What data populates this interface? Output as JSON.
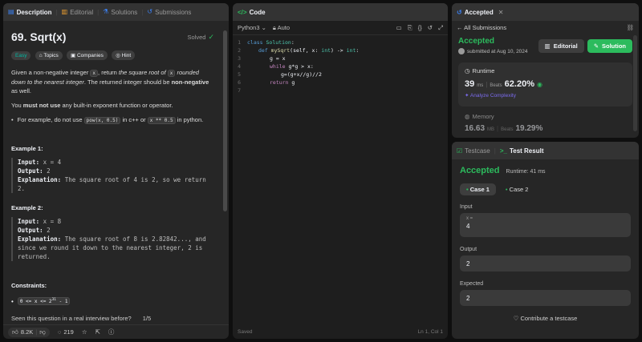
{
  "left": {
    "tabs": [
      {
        "label": "Description"
      },
      {
        "label": "Editorial"
      },
      {
        "label": "Solutions"
      },
      {
        "label": "Submissions"
      }
    ],
    "title": "69. Sqrt(x)",
    "status": "Solved",
    "chips": [
      "Easy",
      "Topics",
      "Companies",
      "Hint"
    ],
    "desc": {
      "p1a": "Given a non-negative integer ",
      "x": "x",
      "p1b": ", return ",
      "p1c": "the square root of ",
      "p1d": " rounded down to the nearest integer",
      "p1e": ". The returned integer should be ",
      "p1f": "non-negative",
      "p1g": " as well.",
      "p2a": "You ",
      "p2b": "must not use",
      "p2c": " any built-in exponent function or operator.",
      "bullet_a": "For example, do not use ",
      "code1": "pow(x, 0.5)",
      "bullet_b": " in c++ or ",
      "code2": "x ** 0.5",
      "bullet_c": " in python."
    },
    "examples": [
      {
        "heading": "Example 1:",
        "input_label": "Input:",
        "input": "x = 4",
        "output_label": "Output:",
        "output": "2",
        "explanation_label": "Explanation:",
        "explanation": "The square root of 4 is 2, so we return 2."
      },
      {
        "heading": "Example 2:",
        "input_label": "Input:",
        "input": "x = 8",
        "output_label": "Output:",
        "output": "2",
        "explanation_label": "Explanation:",
        "explanation": "The square root of 8 is 2.82842..., and since we round it down to the nearest integer, 2 is returned."
      }
    ],
    "constraints_heading": "Constraints:",
    "constraint_base": "0 <= x <= 2",
    "constraint_exp": "31",
    "constraint_tail": " - 1",
    "interview_prompt": "Seen this question in a real interview before?",
    "interview_pages": "1/5",
    "likes": "8.2K",
    "comments": "219"
  },
  "code": {
    "tab": "Code",
    "language": "Python3",
    "mode": "Auto",
    "lines": [
      {
        "n": "1"
      },
      {
        "n": "2"
      },
      {
        "n": "3"
      },
      {
        "n": "4"
      },
      {
        "n": "5"
      },
      {
        "n": "6"
      },
      {
        "n": "7"
      }
    ],
    "text": {
      "class_kw": "class",
      "class_name": "Solution",
      "def_kw": "def",
      "fn_name": "mySqrt",
      "params": "(self, x: ",
      "int1": "int",
      "ret": ") -> ",
      "int2": "int",
      "colon": ":",
      "l3": "g = x",
      "while_kw": "while",
      "l4": " g*g > x:",
      "l5": "g=(g+x//g)//2",
      "return_kw": "return",
      "l6": " g"
    },
    "status_left": "Saved",
    "status_right": "Ln 1, Col 1"
  },
  "submission": {
    "tab": "Accepted",
    "back": "All Submissions",
    "status": "Accepted",
    "submitted": "submitted at Aug 10, 2024",
    "editorial_btn": "Editorial",
    "solution_btn": "Solution",
    "runtime_label": "Runtime",
    "runtime_value": "39",
    "runtime_unit": "ms",
    "beats_label": "Beats",
    "runtime_beats": "62.20%",
    "analyze": "Analyze Complexity",
    "memory_label": "Memory",
    "memory_value": "16.63",
    "memory_unit": "MB",
    "memory_beats": "19.29%"
  },
  "result": {
    "tabs": [
      {
        "label": "Testcase"
      },
      {
        "label": "Test Result"
      }
    ],
    "status": "Accepted",
    "runtime": "Runtime: 41 ms",
    "cases": [
      {
        "label": "Case 1"
      },
      {
        "label": "Case 2"
      }
    ],
    "input_label": "Input",
    "input_var": "x =",
    "input_val": "4",
    "output_label": "Output",
    "output_val": "2",
    "expected_label": "Expected",
    "expected_val": "2",
    "contribute": "Contribute a testcase"
  },
  "colors": {
    "accent_green": "#2cbb5d",
    "easy": "#00b8a3",
    "blue": "#3b82f6",
    "bg": "#0f0f0f",
    "panel": "#262626"
  }
}
